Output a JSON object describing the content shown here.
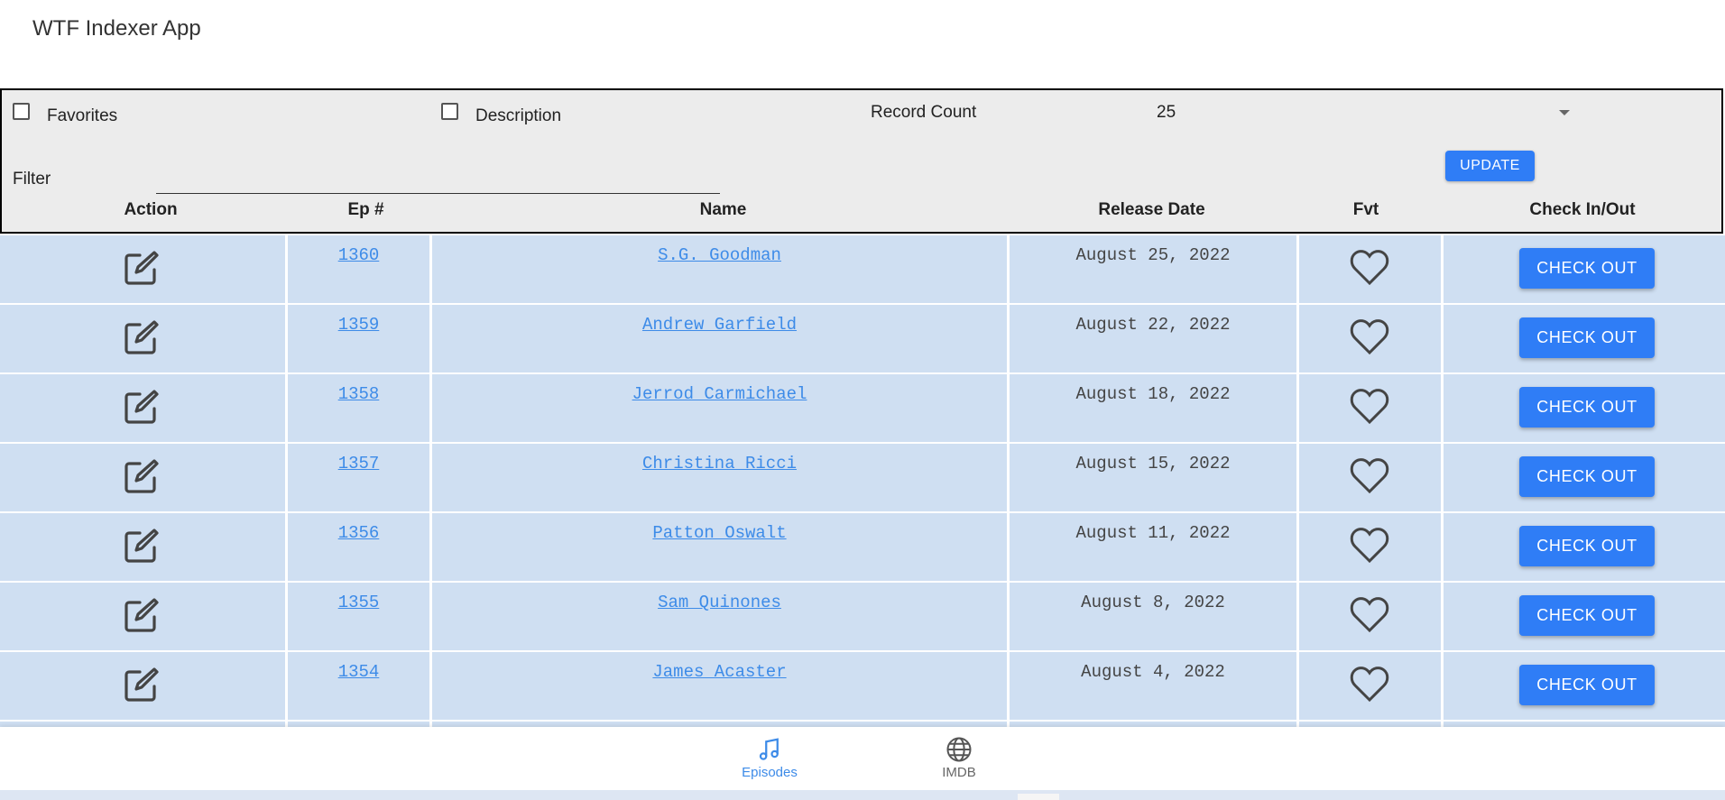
{
  "app": {
    "title": "WTF Indexer App"
  },
  "toolbar": {
    "favorites_label": "Favorites",
    "description_label": "Description",
    "record_count_label": "Record Count",
    "record_count_value": "25",
    "update_label": "UPDATE",
    "filter_label": "Filter",
    "filter_value": ""
  },
  "columns": [
    "Action",
    "Ep #",
    "Name",
    "Release Date",
    "Fvt",
    "Check In/Out"
  ],
  "rows": [
    {
      "ep": "1360",
      "name": "S.G. Goodman",
      "date": "August 25, 2022",
      "button": "CHECK OUT"
    },
    {
      "ep": "1359",
      "name": "Andrew Garfield",
      "date": "August 22, 2022",
      "button": "CHECK OUT"
    },
    {
      "ep": "1358",
      "name": "Jerrod Carmichael",
      "date": "August 18, 2022",
      "button": "CHECK OUT"
    },
    {
      "ep": "1357",
      "name": "Christina Ricci",
      "date": "August 15, 2022",
      "button": "CHECK OUT"
    },
    {
      "ep": "1356",
      "name": "Patton Oswalt",
      "date": "August 11, 2022",
      "button": "CHECK OUT"
    },
    {
      "ep": "1355",
      "name": "Sam Quinones",
      "date": "August 8, 2022",
      "button": "CHECK OUT"
    },
    {
      "ep": "1354",
      "name": "James Acaster",
      "date": "August 4, 2022",
      "button": "CHECK OUT"
    }
  ],
  "bottom_nav": [
    {
      "label": "Episodes",
      "icon": "music-note-icon",
      "active": true
    },
    {
      "label": "IMDB",
      "icon": "globe-icon",
      "active": false
    }
  ],
  "colors": {
    "accent": "#2f7df6",
    "link": "#3d8be8",
    "row_bg": "#cfdff2",
    "toolbar_bg": "#ececec"
  }
}
